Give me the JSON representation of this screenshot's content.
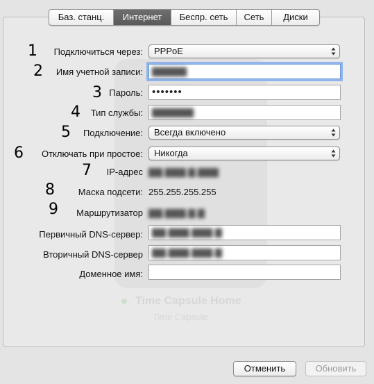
{
  "tabs": [
    {
      "label": "Баз. станц.",
      "active": false
    },
    {
      "label": "Интернет",
      "active": true
    },
    {
      "label": "Беспр. сеть",
      "active": false
    },
    {
      "label": "Сеть",
      "active": false
    },
    {
      "label": "Диски",
      "active": false
    }
  ],
  "markers": [
    "1",
    "2",
    "3",
    "4",
    "5",
    "6",
    "7",
    "8",
    "9"
  ],
  "form": {
    "connect_via": {
      "label": "Подключиться через:",
      "value": "PPPoE"
    },
    "account_name": {
      "label": "Имя учетной записи:",
      "value": "▇▇▇▇▇"
    },
    "password": {
      "label": "Пароль:",
      "value": "•••••••"
    },
    "service_type": {
      "label": "Тип службы:",
      "value": "▇▇▇▇▇▇"
    },
    "connection": {
      "label": "Подключение:",
      "value": "Всегда включено"
    },
    "disconnect_idle": {
      "label": "Отключать при простое:",
      "value": "Никогда"
    },
    "ip_address": {
      "label": "IP-адрес",
      "value": "▇▇.▇▇▇.▇.▇▇▇"
    },
    "subnet_mask": {
      "label": "Маска подсети:",
      "value": "255.255.255.255"
    },
    "router": {
      "label": "Маршрутизатор",
      "value": "▇▇.▇▇▇.▇.▇"
    },
    "dns_primary": {
      "label": "Первичный DNS-сервер:",
      "value": "▇▇.▇▇▇.▇▇▇.▇"
    },
    "dns_secondary": {
      "label": "Вторичный DNS-сервер",
      "value": "▇▇.▇▇▇.▇▇▇.▇"
    },
    "domain_name": {
      "label": "Доменное имя:",
      "value": ""
    }
  },
  "background_watermark": {
    "title": "Time Capsule Home",
    "subtitle": "Time Capsule"
  },
  "buttons": {
    "cancel": "Отменить",
    "update": "Обновить"
  },
  "colors": {
    "active_tab": "#5f5f5f",
    "focus_ring": "#8fb5ea",
    "disabled_text": "#9b9b9b"
  },
  "icons": {
    "select_arrows": "up-down-arrows-icon"
  }
}
